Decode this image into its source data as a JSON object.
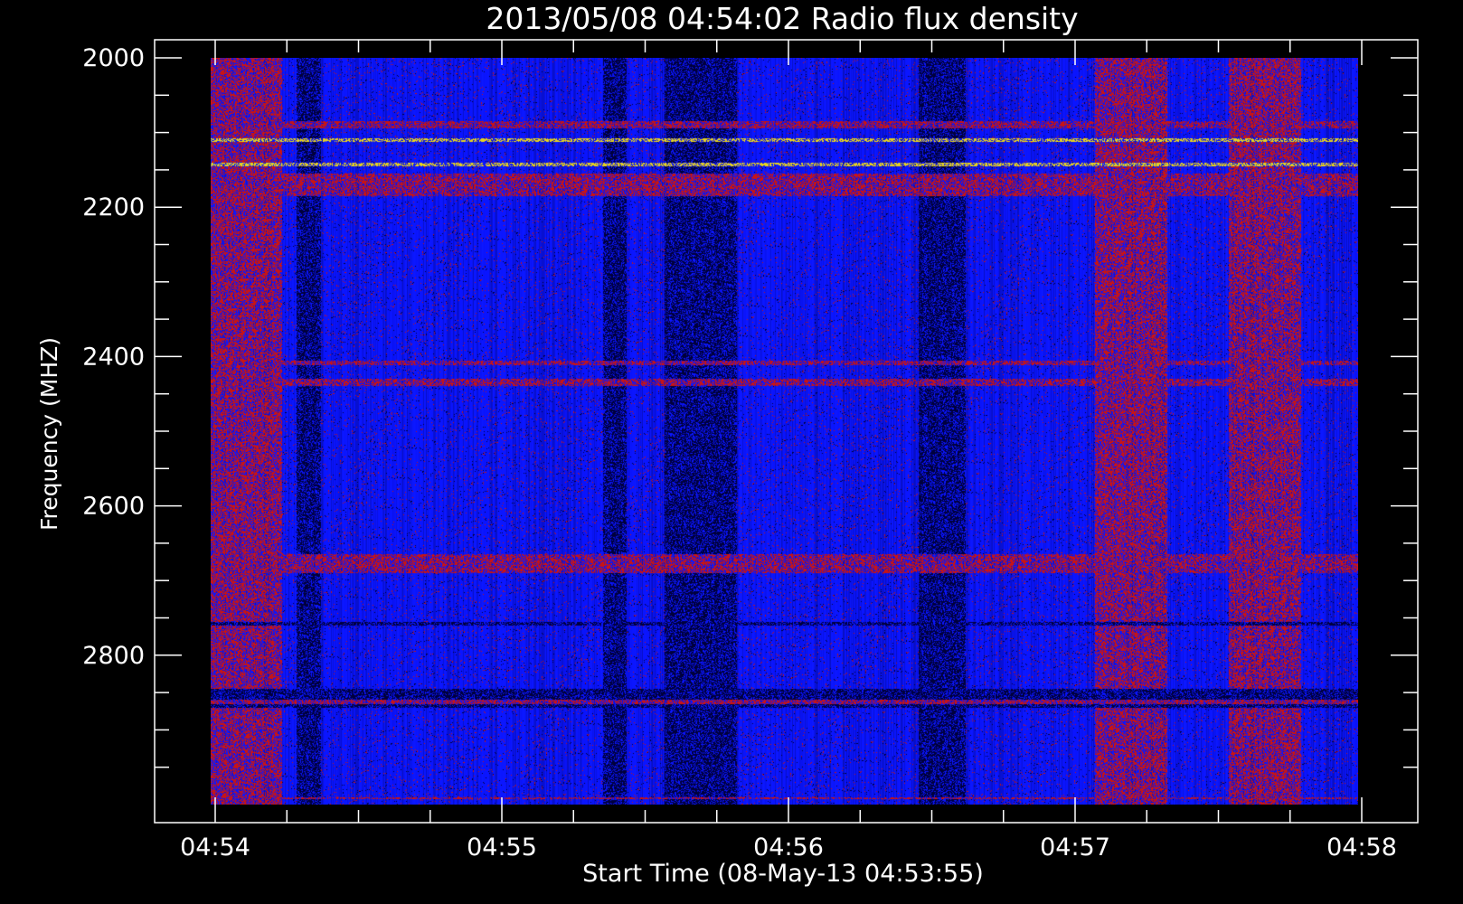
{
  "chart_data": {
    "type": "heatmap",
    "title": "2013/05/08 04:54:02 Radio flux density",
    "xlabel": "Start Time (08-May-13 04:53:55)",
    "ylabel": "Frequency (MHZ)",
    "ylim": [
      2000,
      3000
    ],
    "y_inverted": true,
    "x_tick_labels": [
      "04:54",
      "04:55",
      "04:56",
      "04:57",
      "04:58"
    ],
    "y_tick_labels": [
      "2000",
      "2200",
      "2400",
      "2600",
      "2800"
    ],
    "y_tick_values": [
      2000,
      2200,
      2400,
      2600,
      2800
    ],
    "y_minor_step": 50,
    "x_minor_per_major": 3,
    "colors": {
      "background": "#000000",
      "base": "#0a14ff",
      "dark": "#00003c",
      "red": "#c81414",
      "yellow": "#e6d21e"
    },
    "features": {
      "horizontal_bands_mhz": [
        {
          "from": 2085,
          "to": 2095,
          "level": "red"
        },
        {
          "from": 2108,
          "to": 2112,
          "level": "yellow"
        },
        {
          "from": 2140,
          "to": 2145,
          "level": "yellow"
        },
        {
          "from": 2155,
          "to": 2185,
          "level": "red"
        },
        {
          "from": 2405,
          "to": 2412,
          "level": "red"
        },
        {
          "from": 2430,
          "to": 2440,
          "level": "red"
        },
        {
          "from": 2665,
          "to": 2690,
          "level": "red"
        },
        {
          "from": 2755,
          "to": 2760,
          "level": "dark"
        },
        {
          "from": 2845,
          "to": 2870,
          "level": "dark"
        },
        {
          "from": 2860,
          "to": 2866,
          "level": "red"
        },
        {
          "from": 2990,
          "to": 2993,
          "level": "red"
        }
      ],
      "vertical_bands_time": [
        {
          "from": "04:54:00",
          "to": "04:54:15",
          "level": "red"
        },
        {
          "from": "04:54:18",
          "to": "04:54:23",
          "level": "dark"
        },
        {
          "from": "04:55:22",
          "to": "04:55:27",
          "level": "dark"
        },
        {
          "from": "04:55:35",
          "to": "04:55:50",
          "level": "dark"
        },
        {
          "from": "04:56:28",
          "to": "04:56:38",
          "level": "dark"
        },
        {
          "from": "04:57:05",
          "to": "04:57:20",
          "level": "red"
        },
        {
          "from": "04:57:33",
          "to": "04:57:48",
          "level": "red"
        }
      ]
    }
  }
}
